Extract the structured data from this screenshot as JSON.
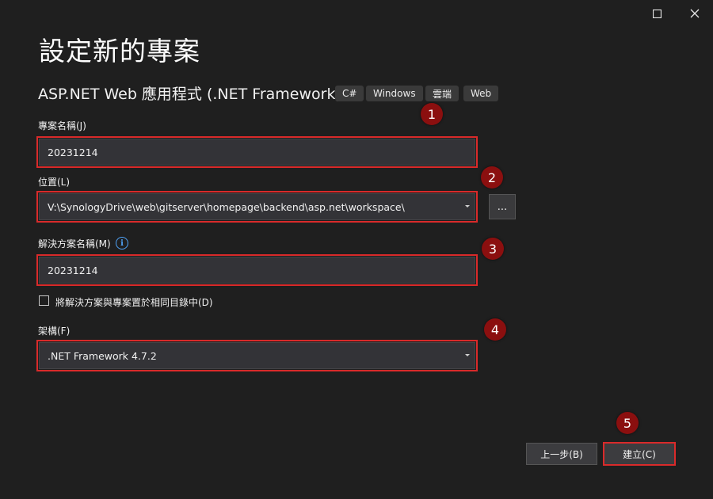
{
  "window": {
    "maximize_icon": "maximize-icon",
    "close_icon": "close-icon"
  },
  "header": {
    "title": "設定新的專案",
    "subtitle": "ASP.NET Web 應用程式 (.NET Framework)",
    "tags": [
      "C#",
      "Windows",
      "雲端",
      "Web"
    ]
  },
  "form": {
    "project_name_label": "專案名稱(J)",
    "project_name_value": "20231214",
    "location_label": "位置(L)",
    "location_value": "V:\\SynologyDrive\\web\\gitserver\\homepage\\backend\\asp.net\\workspace\\",
    "browse_label": "...",
    "solution_name_label": "解決方案名稱(M)",
    "solution_name_value": "20231214",
    "info_icon": "i",
    "same_dir_label": "將解決方案與專案置於相同目錄中(D)",
    "same_dir_checked": false,
    "framework_label": "架構(F)",
    "framework_value": ".NET Framework 4.7.2"
  },
  "annotations": [
    "1",
    "2",
    "3",
    "4",
    "5"
  ],
  "buttons": {
    "back_label": "上一步(B)",
    "create_label": "建立(C)"
  },
  "colors": {
    "background": "#1f1f1f",
    "field_bg": "#333337",
    "highlight": "#d92a2a",
    "badge": "#8b0f0f",
    "info": "#4fa3f7"
  }
}
